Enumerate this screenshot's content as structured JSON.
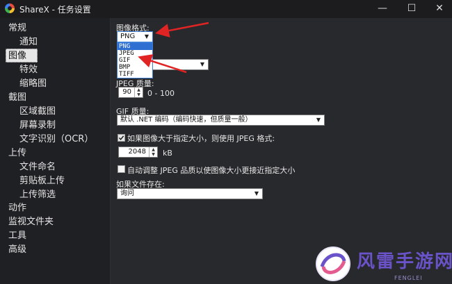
{
  "window": {
    "title": "ShareX - 任务设置"
  },
  "sidebar": {
    "items": [
      "常规",
      "通知",
      "图像",
      "特效",
      "缩略图",
      "截图",
      "区域截图",
      "屏幕录制",
      "文字识别（OCR）",
      "上传",
      "文件命名",
      "剪贴板上传",
      "上传筛选",
      "动作",
      "监视文件夹",
      "工具",
      "高级"
    ],
    "selected": "图像"
  },
  "image_format": {
    "label": "图像格式:",
    "value": "PNG",
    "options": [
      "PNG",
      "JPEG",
      "GIF",
      "BMP",
      "TIFF"
    ],
    "highlighted": "PNG"
  },
  "jpeg_quality": {
    "label": "JPEG 质量:",
    "value": "90",
    "range": "0 - 100"
  },
  "gif_quality": {
    "label": "GIF 质量:",
    "value": "默认 .NET 编码（编码快速，但质量一般）"
  },
  "use_jpeg_if_larger": {
    "label": "如果图像大于指定大小，则使用 JPEG 格式:",
    "checked": true
  },
  "size_limit": {
    "value": "2048",
    "unit": "kB"
  },
  "auto_adjust_jpeg": {
    "label": "自动调整 JPEG 品质以使图像大小更接近指定大小",
    "checked": false
  },
  "file_exists": {
    "label": "如果文件存在:",
    "value": "询问"
  },
  "watermark": {
    "text": "风雷手游网",
    "sub": "FENGLEI"
  },
  "colors": {
    "arrow": "#e02424",
    "accent": "#2f6fd1"
  }
}
